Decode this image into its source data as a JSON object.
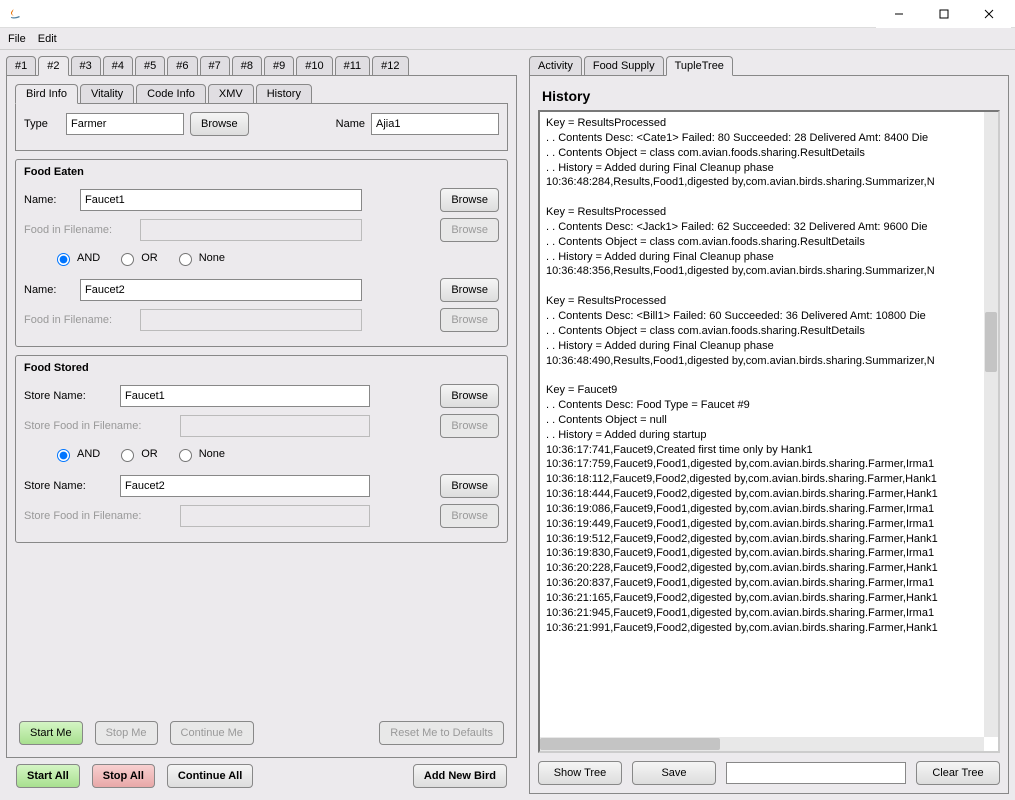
{
  "menubar": {
    "file": "File",
    "edit": "Edit"
  },
  "hashTabs": [
    "#1",
    "#2",
    "#3",
    "#4",
    "#5",
    "#6",
    "#7",
    "#8",
    "#9",
    "#10",
    "#11",
    "#12"
  ],
  "hashTabActive": 1,
  "innerTabs": [
    "Bird Info",
    "Vitality",
    "Code Info",
    "XMV",
    "History"
  ],
  "innerTabActive": 0,
  "birdInfo": {
    "typeLabel": "Type",
    "typeValue": "Farmer",
    "browse": "Browse",
    "nameLabel": "Name",
    "nameValue": "Ajia1"
  },
  "foodEaten": {
    "title": "Food Eaten",
    "nameLabel": "Name:",
    "name1": "Faucet1",
    "fifLabel": "Food in Filename:",
    "radios": [
      "AND",
      "OR",
      "None"
    ],
    "radioSel": 0,
    "name2": "Faucet2"
  },
  "foodStored": {
    "title": "Food Stored",
    "storeNameLabel": "Store Name:",
    "store1": "Faucet1",
    "sfifLabel": "Store Food in Filename:",
    "radios": [
      "AND",
      "OR",
      "None"
    ],
    "radioSel": 0,
    "store2": "Faucet2"
  },
  "birdButtons": {
    "start": "Start Me",
    "stop": "Stop Me",
    "cont": "Continue Me",
    "reset": "Reset Me to Defaults"
  },
  "globalButtons": {
    "startAll": "Start All",
    "stopAll": "Stop All",
    "contAll": "Continue All",
    "addNew": "Add New Bird"
  },
  "rightTabs": [
    "Activity",
    "Food Supply",
    "TupleTree"
  ],
  "rightTabActive": 2,
  "historyTitle": "History",
  "historyLines": [
    "Key = ResultsProcessed",
    " . . Contents Desc: <Cate1> Failed: 80 Succeeded: 28 Delivered Amt: 8400   Die",
    " . . Contents Object = class com.avian.foods.sharing.ResultDetails",
    " . . History = Added during Final Cleanup phase",
    "10:36:48:284,Results,Food1,digested by,com.avian.birds.sharing.Summarizer,N",
    "",
    "Key = ResultsProcessed",
    " . . Contents Desc: <Jack1> Failed: 62 Succeeded: 32 Delivered Amt: 9600   Die",
    " . . Contents Object = class com.avian.foods.sharing.ResultDetails",
    " . . History = Added during Final Cleanup phase",
    "10:36:48:356,Results,Food1,digested by,com.avian.birds.sharing.Summarizer,N",
    "",
    "Key = ResultsProcessed",
    " . . Contents Desc: <Bill1> Failed: 60 Succeeded: 36 Delivered Amt: 10800   Die",
    " . . Contents Object = class com.avian.foods.sharing.ResultDetails",
    " . . History = Added during Final Cleanup phase",
    "10:36:48:490,Results,Food1,digested by,com.avian.birds.sharing.Summarizer,N",
    "",
    "Key = Faucet9",
    " . . Contents Desc: Food Type = Faucet #9",
    " . . Contents Object = null",
    " . . History = Added during startup",
    "10:36:17:741,Faucet9,Created first time only by Hank1",
    "10:36:17:759,Faucet9,Food1,digested by,com.avian.birds.sharing.Farmer,Irma1",
    "10:36:18:112,Faucet9,Food2,digested by,com.avian.birds.sharing.Farmer,Hank1",
    "10:36:18:444,Faucet9,Food2,digested by,com.avian.birds.sharing.Farmer,Hank1",
    "10:36:19:086,Faucet9,Food1,digested by,com.avian.birds.sharing.Farmer,Irma1",
    "10:36:19:449,Faucet9,Food1,digested by,com.avian.birds.sharing.Farmer,Irma1",
    "10:36:19:512,Faucet9,Food2,digested by,com.avian.birds.sharing.Farmer,Hank1",
    "10:36:19:830,Faucet9,Food1,digested by,com.avian.birds.sharing.Farmer,Irma1",
    "10:36:20:228,Faucet9,Food2,digested by,com.avian.birds.sharing.Farmer,Hank1",
    "10:36:20:837,Faucet9,Food1,digested by,com.avian.birds.sharing.Farmer,Irma1",
    "10:36:21:165,Faucet9,Food2,digested by,com.avian.birds.sharing.Farmer,Hank1",
    "10:36:21:945,Faucet9,Food1,digested by,com.avian.birds.sharing.Farmer,Irma1",
    "10:36:21:991,Faucet9,Food2,digested by,com.avian.birds.sharing.Farmer,Hank1"
  ],
  "treeButtons": {
    "show": "Show Tree",
    "save": "Save",
    "clear": "Clear Tree"
  }
}
